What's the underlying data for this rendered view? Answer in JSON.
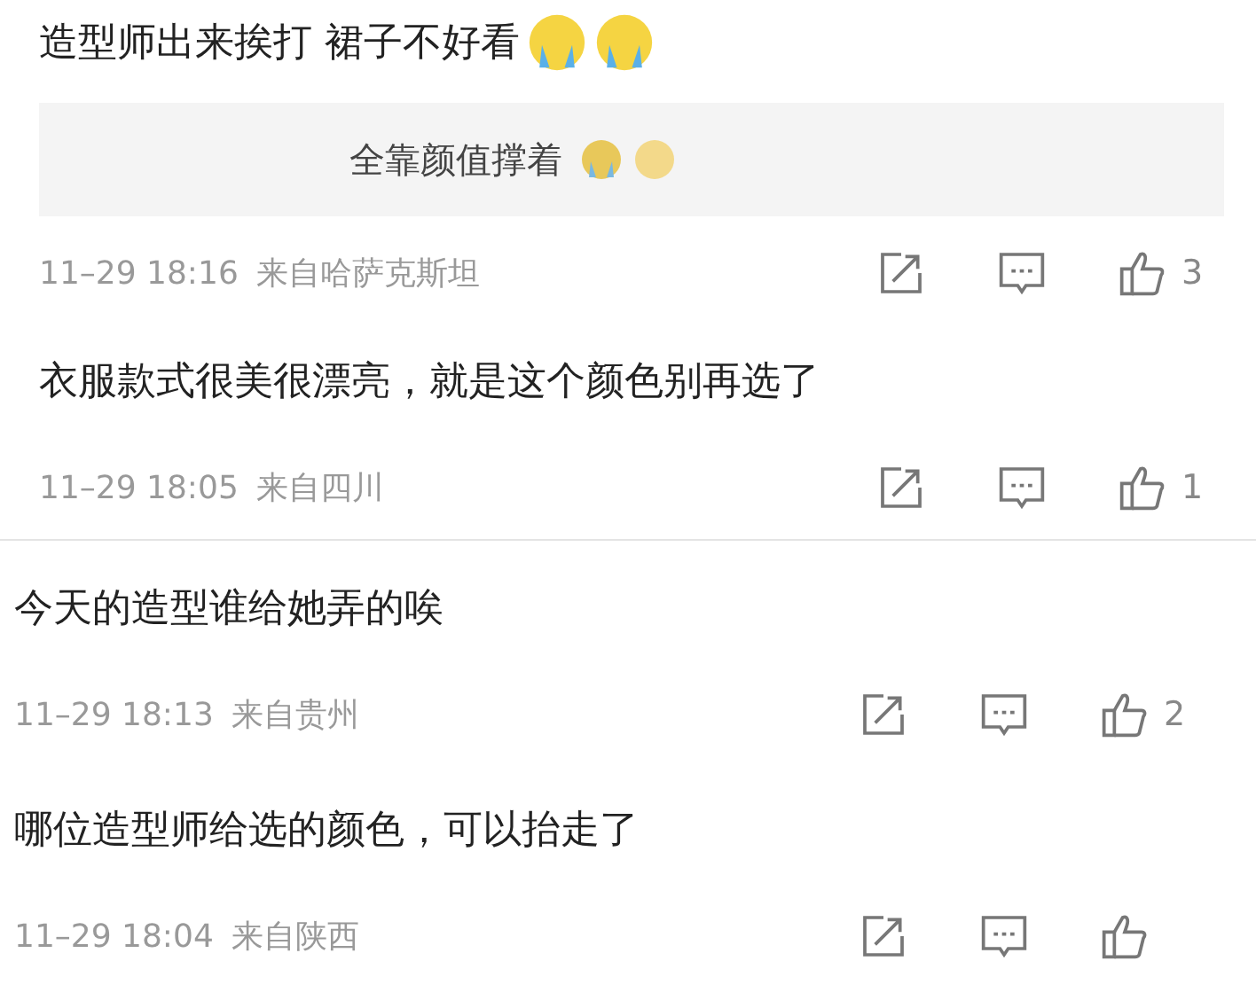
{
  "sections": [
    {
      "comments": [
        {
          "text": "造型师出来挨打 裙子不好看",
          "emojis": [
            {
              "kind": "crying"
            },
            {
              "kind": "crying"
            }
          ],
          "reply": {
            "text": "全靠颜值撑着",
            "emojis": [
              {
                "kind": "sob"
              },
              {
                "kind": "doge"
              }
            ]
          },
          "time": "11–29 18:16",
          "location": "来自哈萨克斯坦",
          "likes": "3"
        },
        {
          "text": "衣服款式很美很漂亮，就是这个颜色别再选了",
          "time": "11–29 18:05",
          "location": "来自四川",
          "likes": "1"
        }
      ]
    },
    {
      "comments": [
        {
          "text": "今天的造型谁给她弄的唉",
          "time": "11–29 18:13",
          "location": "来自贵州",
          "likes": "2"
        },
        {
          "text": "哪位造型师给选的颜色，可以抬走了",
          "time": "11–29 18:04",
          "location": "来自陕西"
        }
      ]
    }
  ]
}
